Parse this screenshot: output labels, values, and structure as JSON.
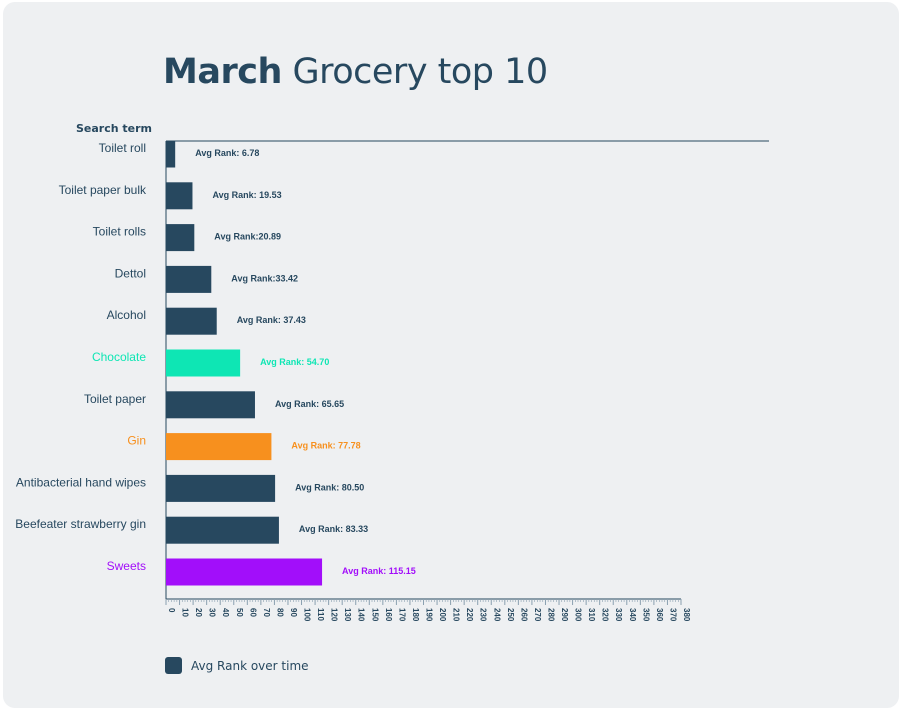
{
  "title": {
    "bold": "March",
    "rest": " Grocery top 10"
  },
  "chart_data": {
    "type": "bar",
    "orientation": "horizontal",
    "title": "March Grocery top 10",
    "ylabel": "Search term",
    "xlim": [
      0,
      380
    ],
    "x_ticks": [
      0,
      10,
      20,
      30,
      40,
      50,
      60,
      70,
      80,
      90,
      100,
      110,
      120,
      130,
      140,
      150,
      160,
      170,
      180,
      190,
      200,
      210,
      220,
      230,
      240,
      250,
      260,
      270,
      280,
      290,
      300,
      310,
      320,
      330,
      340,
      350,
      360,
      370,
      380
    ],
    "categories": [
      "Toilet roll",
      "Toilet paper bulk",
      "Toilet rolls",
      "Dettol",
      "Alcohol",
      "Chocolate",
      "Toilet paper",
      "Gin",
      "Antibacterial hand wipes",
      "Beefeater strawberry gin",
      "Sweets"
    ],
    "values": [
      6.78,
      19.53,
      20.89,
      33.42,
      37.43,
      54.7,
      65.65,
      77.78,
      80.5,
      83.33,
      115.15
    ],
    "value_labels": [
      "Avg Rank: 6.78",
      "Avg Rank: 19.53",
      "Avg Rank:20.89",
      "Avg Rank:33.42",
      "Avg Rank: 37.43",
      "Avg Rank: 54.70",
      "Avg Rank: 65.65",
      "Avg Rank: 77.78",
      "Avg Rank: 80.50",
      "Avg Rank: 83.33",
      "Avg Rank: 115.15"
    ],
    "colors": [
      "#27485f",
      "#27485f",
      "#27485f",
      "#27485f",
      "#27485f",
      "#0ee6b4",
      "#27485f",
      "#f7901e",
      "#27485f",
      "#27485f",
      "#a20efa"
    ],
    "label_colors": [
      "#27485f",
      "#27485f",
      "#27485f",
      "#27485f",
      "#27485f",
      "#0ee6b4",
      "#27485f",
      "#f7901e",
      "#27485f",
      "#27485f",
      "#a20efa"
    ],
    "legend": {
      "label": "Avg Rank over time",
      "color": "#27485f",
      "position": "bottom-left"
    },
    "grid": false
  }
}
